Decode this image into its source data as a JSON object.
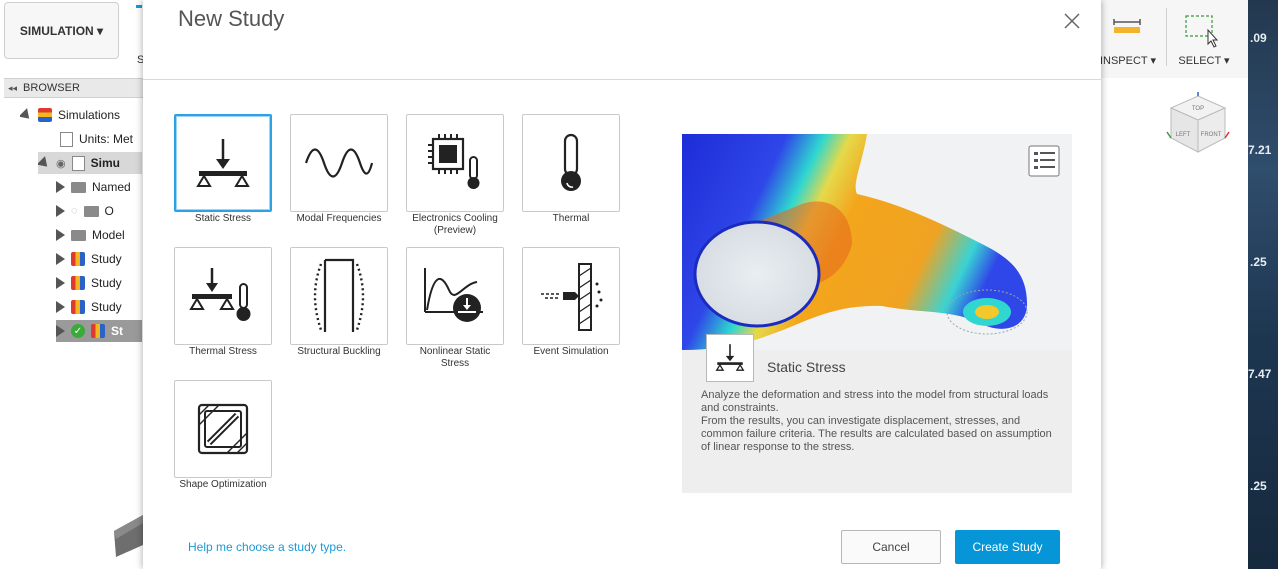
{
  "app": {
    "workspace_button": "SIMULATION ▾",
    "toolbar": {
      "fragment_label": "S",
      "inspect_label": "INSPECT ▾",
      "select_label": "SELECT ▾"
    },
    "browser": {
      "header": "BROWSER",
      "rows": [
        {
          "label": "Simulations"
        },
        {
          "label": "Units: Met"
        },
        {
          "label": "Simu"
        },
        {
          "label": "Named"
        },
        {
          "label": "O"
        },
        {
          "label": "Model"
        },
        {
          "label": "Study"
        },
        {
          "label": "Study"
        },
        {
          "label": "Study"
        },
        {
          "label": "St"
        }
      ]
    },
    "right_strip_values": [
      ".09",
      "7.21",
      ".25",
      "7.47",
      ".25"
    ],
    "viewcube": {
      "top": "TOP",
      "left": "LEFT",
      "front": "FRONT"
    }
  },
  "dialog": {
    "title": "New Study",
    "study_types": [
      {
        "label": "Static Stress",
        "icon": "static-stress-icon",
        "selected": true
      },
      {
        "label": "Modal Frequencies",
        "icon": "modal-frequencies-icon",
        "selected": false
      },
      {
        "label": "Electronics Cooling\n(Preview)",
        "icon": "electronics-cooling-icon",
        "selected": false
      },
      {
        "label": "Thermal",
        "icon": "thermometer-icon",
        "selected": false
      },
      {
        "label": "Thermal Stress",
        "icon": "thermal-stress-icon",
        "selected": false
      },
      {
        "label": "Structural Buckling",
        "icon": "structural-buckling-icon",
        "selected": false
      },
      {
        "label": "Nonlinear Static\nStress",
        "icon": "nonlinear-static-stress-icon",
        "selected": false
      },
      {
        "label": "Event Simulation",
        "icon": "event-simulation-icon",
        "selected": false
      },
      {
        "label": "Shape Optimization",
        "icon": "shape-optimization-icon",
        "selected": false
      }
    ],
    "preview": {
      "title": "Static Stress",
      "description_lines": [
        "Analyze the deformation and stress into the model from structural loads and constraints.",
        "From the results, you can investigate displacement, stresses, and common failure criteria. The results are calculated based on assumption of linear response to the stress."
      ]
    },
    "help_link": "Help me choose a study type.",
    "cancel_label": "Cancel",
    "create_label": "Create Study"
  },
  "colors": {
    "accent": "#0696d7",
    "selected_border": "#2ba2e4",
    "link": "#1a9ad6"
  }
}
